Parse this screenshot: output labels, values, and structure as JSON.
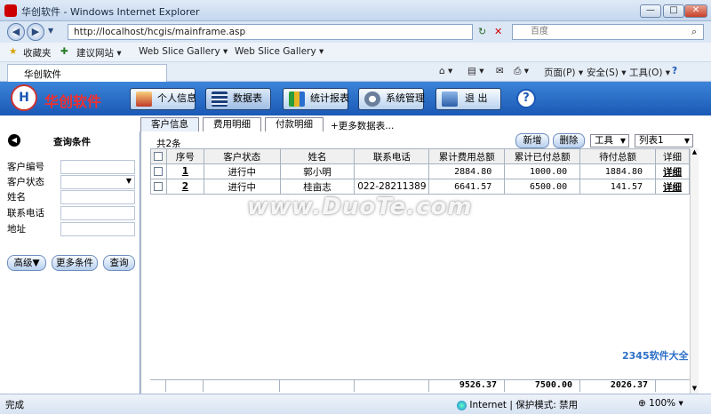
{
  "window": {
    "title": "华创软件 - Windows Internet Explorer",
    "min": "—",
    "max": "□",
    "close": "✕"
  },
  "address": {
    "url": "http://localhost/hcgis/mainframe.asp",
    "search_placeholder": "百度"
  },
  "favbar": {
    "favorites": "收藏夹",
    "items": [
      "建议网站 ▾",
      "Web Slice Gallery ▾",
      "Web Slice Gallery ▾"
    ]
  },
  "tab": {
    "title": "华创软件"
  },
  "commands": {
    "page": "页面(P) ▾",
    "safety": "安全(S) ▾",
    "tools": "工具(O) ▾",
    "help": "?"
  },
  "app": {
    "logo_text": "华创软件",
    "logo_mark": "H",
    "nav": [
      "个人信息",
      "数据表",
      "统计报表",
      "系统管理",
      "退 出"
    ],
    "help": "?",
    "subtabs": [
      "客户信息",
      "费用明细",
      "付款明细",
      "+更多数据表..."
    ]
  },
  "left_panel": {
    "back_icon": "◀",
    "title": "查询条件",
    "fields": [
      {
        "label": "客户编号",
        "value": ""
      },
      {
        "label": "客户状态",
        "value": ""
      },
      {
        "label": "姓名",
        "value": ""
      },
      {
        "label": "联系电话",
        "value": ""
      },
      {
        "label": "地址",
        "value": ""
      }
    ],
    "buttons": [
      "高级▼",
      "更多条件",
      "查询"
    ]
  },
  "grid": {
    "count_text": "共2条",
    "buttons": {
      "new": "新增",
      "delete": "删除"
    },
    "tools_dropdown": "工具",
    "list_dropdown": "列表1",
    "columns": [
      "",
      "序号",
      "客户状态",
      "姓名",
      "联系电话",
      "累计费用总额",
      "累计已付总额",
      "待付总额",
      "详细"
    ],
    "rows": [
      {
        "no": "1",
        "status": "进行中",
        "name": "郭小明",
        "phone": "",
        "total": "2884.80",
        "paid": "1000.00",
        "due": "1884.80",
        "detail": "详细"
      },
      {
        "no": "2",
        "status": "进行中",
        "name": "桂亩志",
        "phone": "022-28211389",
        "total": "6641.57",
        "paid": "6500.00",
        "due": "141.57",
        "detail": "详细"
      }
    ],
    "totals": {
      "total": "9526.37",
      "paid": "7500.00",
      "due": "2026.37"
    }
  },
  "watermark": {
    "text": "www.DuoTe.com",
    "corner": "2345软件大全"
  },
  "status": {
    "left": "完成",
    "zone": "Internet | 保护模式: 禁用",
    "zoom": "100%"
  }
}
